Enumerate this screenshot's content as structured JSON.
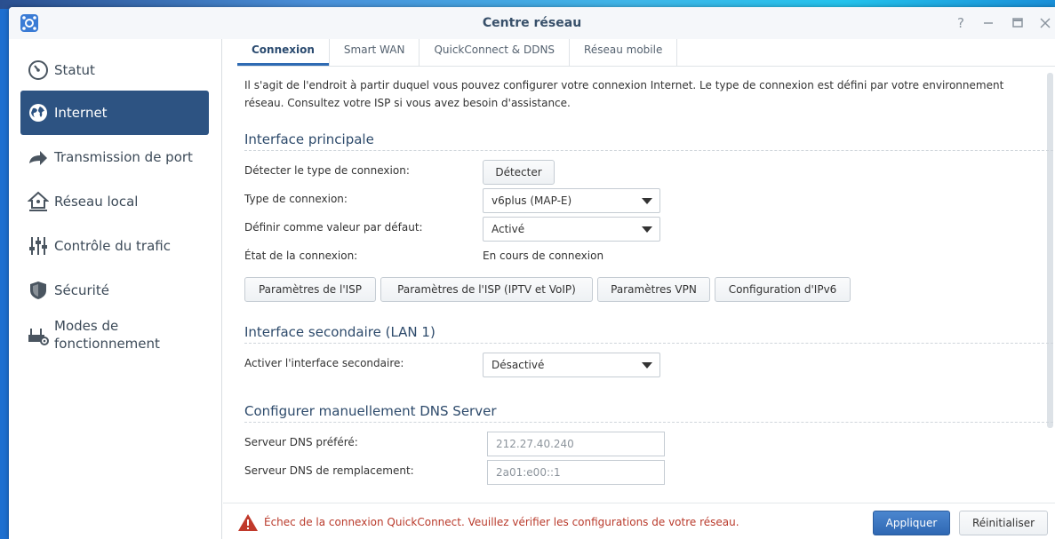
{
  "window": {
    "title": "Centre réseau",
    "controls": [
      "help-icon",
      "minimize-icon",
      "maximize-icon",
      "close-icon"
    ]
  },
  "sidebar": {
    "items": [
      {
        "label": "Statut",
        "icon": "gauge-icon",
        "active": false
      },
      {
        "label": "Internet",
        "icon": "globe-icon",
        "active": true
      },
      {
        "label": "Transmission de port",
        "icon": "forward-arrow-icon",
        "active": false
      },
      {
        "label": "Réseau local",
        "icon": "home-network-icon",
        "active": false
      },
      {
        "label": "Contrôle du trafic",
        "icon": "sliders-icon",
        "active": false
      },
      {
        "label": "Sécurité",
        "icon": "shield-icon",
        "active": false
      },
      {
        "label": "Modes de fonctionnement",
        "icon": "router-icon",
        "active": false
      }
    ]
  },
  "tabs": [
    {
      "label": "Connexion",
      "active": true
    },
    {
      "label": "Smart WAN",
      "active": false
    },
    {
      "label": "QuickConnect & DDNS",
      "active": false
    },
    {
      "label": "Réseau mobile",
      "active": false
    }
  ],
  "main": {
    "description": "Il s'agit de l'endroit à partir duquel vous pouvez configurer votre connexion Internet. Le type de connexion est défini par votre environnement réseau. Consultez votre ISP si vous avez besoin d'assistance.",
    "primary": {
      "title": "Interface principale",
      "detect_label": "Détecter le type de connexion:",
      "detect_button": "Détecter",
      "type_label": "Type de connexion:",
      "type_value": "v6plus (MAP-E)",
      "default_label": "Définir comme valeur par défaut:",
      "default_value": "Activé",
      "state_label": "État de la connexion:",
      "state_value": "En cours de connexion",
      "buttons": [
        "Paramètres de l'ISP",
        "Paramètres de l'ISP (IPTV et VoIP)",
        "Paramètres VPN",
        "Configuration d'IPv6"
      ]
    },
    "secondary": {
      "title": "Interface secondaire (LAN 1)",
      "enable_label": "Activer l'interface secondaire:",
      "enable_value": "Désactivé"
    },
    "dns": {
      "title": "Configurer manuellement DNS Server",
      "preferred_label": "Serveur DNS préféré:",
      "preferred_value": "212.27.40.240",
      "alternate_label": "Serveur DNS de remplacement:",
      "alternate_value": "2a01:e00::1"
    }
  },
  "footer": {
    "warning": "Échec de la connexion QuickConnect. Veuillez vérifier les configurations de votre réseau.",
    "apply": "Appliquer",
    "reset": "Réinitialiser"
  },
  "colors": {
    "accent": "#2d5382",
    "apply": "#3a75c0",
    "warning": "#b93a2b"
  }
}
